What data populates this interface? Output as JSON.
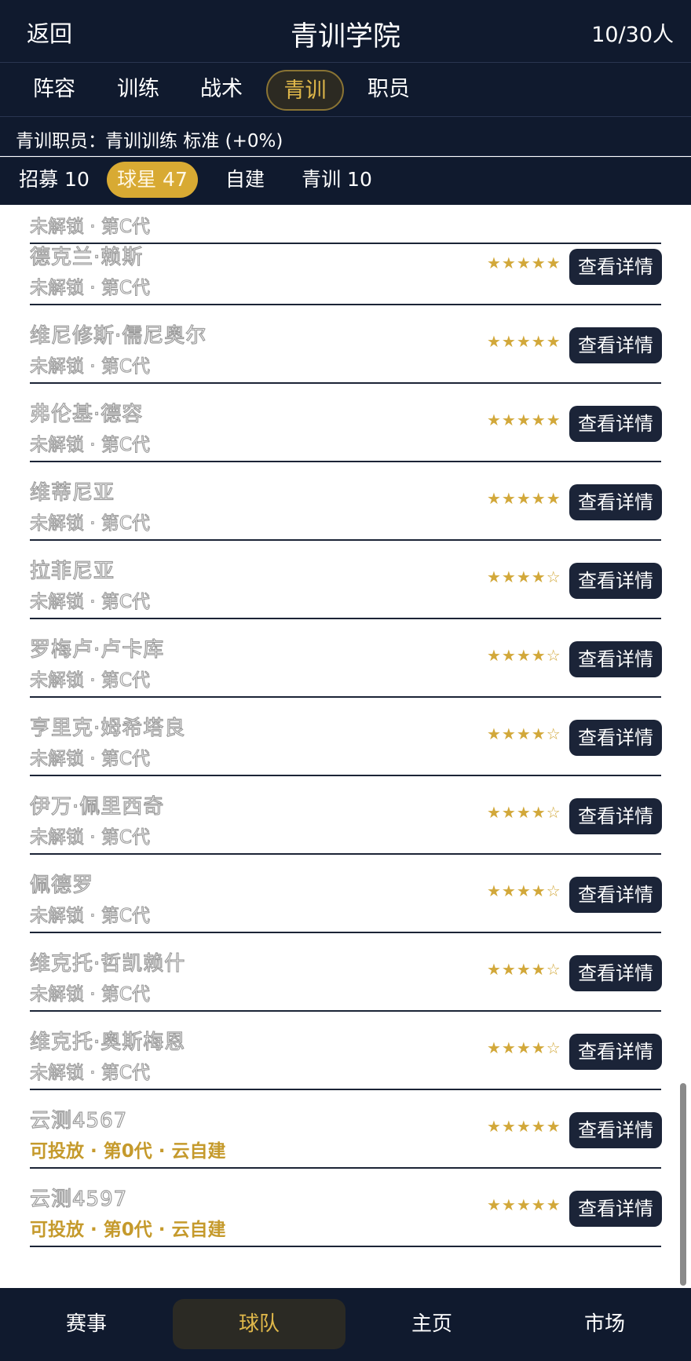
{
  "header": {
    "back_label": "返回",
    "title": "青训学院",
    "count": "10/30人"
  },
  "tabs": [
    {
      "label": "阵容"
    },
    {
      "label": "训练"
    },
    {
      "label": "战术"
    },
    {
      "label": "青训",
      "active": true
    },
    {
      "label": "职员"
    }
  ],
  "staff_line": {
    "label": "青训职员：",
    "value": "青训训练 标准 (+0%)"
  },
  "subtabs": [
    {
      "label": "招募 10"
    },
    {
      "label": "球星 47",
      "active": true
    },
    {
      "label": "自建"
    },
    {
      "label": "青训 10"
    }
  ],
  "list": {
    "partial_top_status": "未解锁 · 第C代",
    "detail_label": "查看详情",
    "players": [
      {
        "name": "德克兰·赖斯",
        "status": "未解锁 · 第C代",
        "stars": 5
      },
      {
        "name": "维尼修斯·儒尼奥尔",
        "status": "未解锁 · 第C代",
        "stars": 5
      },
      {
        "name": "弗伦基·德容",
        "status": "未解锁 · 第C代",
        "stars": 5
      },
      {
        "name": "维蒂尼亚",
        "status": "未解锁 · 第C代",
        "stars": 5
      },
      {
        "name": "拉菲尼亚",
        "status": "未解锁 · 第C代",
        "stars": 4
      },
      {
        "name": "罗梅卢·卢卡库",
        "status": "未解锁 · 第C代",
        "stars": 4
      },
      {
        "name": "亨里克·姆希塔良",
        "status": "未解锁 · 第C代",
        "stars": 4
      },
      {
        "name": "伊万·佩里西奇",
        "status": "未解锁 · 第C代",
        "stars": 4
      },
      {
        "name": "佩德罗",
        "status": "未解锁 · 第C代",
        "stars": 4
      },
      {
        "name": "维克托·哲凯赖什",
        "status": "未解锁 · 第C代",
        "stars": 4
      },
      {
        "name": "维克托·奥斯梅恩",
        "status": "未解锁 · 第C代",
        "stars": 4
      },
      {
        "name": "云测4567",
        "status": "可投放 · 第0代 · 云自建",
        "stars": 5,
        "gold": true
      },
      {
        "name": "云测4597",
        "status": "可投放 · 第0代 · 云自建",
        "stars": 5,
        "gold": true
      }
    ]
  },
  "bottom_nav": [
    {
      "label": "赛事"
    },
    {
      "label": "球队",
      "active": true
    },
    {
      "label": "主页"
    },
    {
      "label": "市场"
    }
  ],
  "colors": {
    "dark_bg": "#101a2e",
    "gold": "#d8aa33",
    "button_bg": "#1b2438"
  }
}
